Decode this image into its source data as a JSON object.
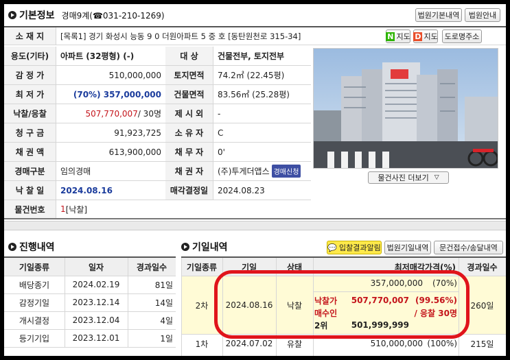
{
  "basic": {
    "title": "기본정보",
    "case_no": "경매9계(☎031-210-1269)",
    "btn_court_basic": "법원기본내역",
    "btn_court_info": "법원안내",
    "address_label": "소 재 지",
    "address_value": "[목록1] 경기 화성시 능동    9 0    더원아파트      5    중      호 [동탄원천로 315-34]",
    "map_n": "지도",
    "map_d": "지도",
    "road_btn": "도로명주소",
    "left_rows": [
      {
        "label": "용도(기타)",
        "value": "아파트 (32평형) (-)"
      },
      {
        "label": "감 정 가",
        "value": "510,000,000"
      },
      {
        "label": "최 저 가",
        "value": "(70%) 357,000,000"
      },
      {
        "label": "낙찰/응찰",
        "value_a": "507,770,007",
        "value_b": " / 30명"
      },
      {
        "label": "청 구 금",
        "value": "91,923,725"
      },
      {
        "label": "채 권 액",
        "value": "613,900,000"
      },
      {
        "label": "경매구분",
        "value": "임의경매"
      },
      {
        "label": "낙 찰 일",
        "value": "2024.08.16"
      }
    ],
    "right_rows": [
      {
        "label": "대      상",
        "value": "건물전부, 토지전부"
      },
      {
        "label": "토지면적",
        "value": "74.2㎡ (22.45평)"
      },
      {
        "label": "건물면적",
        "value": "83.56㎡ (25.28평)"
      },
      {
        "label": "제 시 외",
        "value": "-"
      },
      {
        "label": "소 유 자",
        "value": "C"
      },
      {
        "label": "채 무 자",
        "value": "0'"
      },
      {
        "label": "채 권 자",
        "value": "(주)투게더앱스",
        "badge": "경매신청"
      },
      {
        "label": "매각결정일",
        "value": "2024.08.23"
      }
    ],
    "item_no_label": "물건번호",
    "item_no_value_num": "1",
    "item_no_value_text": " [낙찰]",
    "photo_btn": "물건사진 더보기"
  },
  "progress": {
    "title": "진행내역",
    "headers": [
      "기일종류",
      "일자",
      "경과일수"
    ],
    "rows": [
      [
        "배당종기",
        "2024.02.19",
        "81일"
      ],
      [
        "감정기일",
        "2023.12.14",
        "14일"
      ],
      [
        "개시결정",
        "2023.12.04",
        "4일"
      ],
      [
        "등기기입",
        "2023.12.01",
        "1일"
      ]
    ]
  },
  "schedule": {
    "title": "기일내역",
    "btn_alert": "입찰결과알림",
    "btn_court": "법원기일내역",
    "btn_docs": "문건접수/송달내역",
    "headers": [
      "기일종류",
      "기일",
      "상태",
      "최저매각가격(%)",
      "경과일수"
    ],
    "row1": {
      "kind": "2차",
      "date": "2024.08.16",
      "status": "낙찰",
      "min_price": "357,000,000",
      "min_pct": "(70%)",
      "win_label": "낙찰가",
      "win_price": "507,770,007",
      "win_pct": "(99.56%)",
      "buyer_label": "매수인",
      "buyer_value": "/ 응찰 30명",
      "second_label": "2위",
      "second_price": "501,999,999",
      "days": "260일"
    },
    "row2": {
      "kind": "1차",
      "date": "2024.07.02",
      "status": "유찰",
      "price": "510,000,000",
      "pct": "(100%)",
      "days": "215일"
    }
  },
  "colors": {
    "highlight_row": "#fffbd6",
    "red_circle": "#e0141b",
    "blue_text": "#1a3b9c"
  }
}
